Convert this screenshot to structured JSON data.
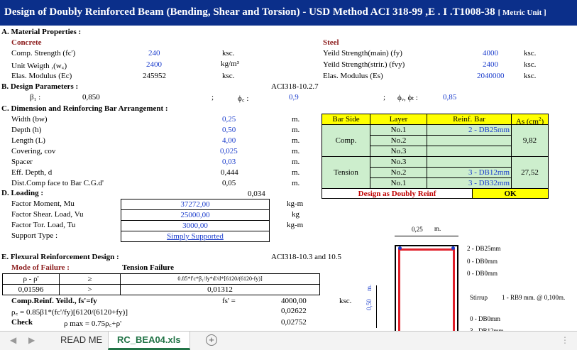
{
  "title": "Design of Doubly Reinforced Beam (Bending, Shear and Torsion) - USD Method ACI 318-99 ,E . I .T1008-38",
  "title_unit": "[ Metric Unit ]",
  "sectionA": {
    "header": "A. Material Properties :",
    "concrete_header": "Concrete",
    "steel_header": "Steel",
    "concrete_rows": [
      {
        "label": "Comp. Strength (fc')",
        "value": "240",
        "unit": "ksc."
      },
      {
        "label": "Unit Weigth ,(w꜀)",
        "value": "2400",
        "unit": "kg/m³"
      },
      {
        "label": "Elas. Modulus (Ec)",
        "value": "245952",
        "unit": "ksc."
      }
    ],
    "steel_rows": [
      {
        "label": "Yeild Strength(main) (fy)",
        "value": "4000",
        "unit": "ksc."
      },
      {
        "label": "Yeild Strength(strir.) (fvy)",
        "value": "2400",
        "unit": "ksc."
      },
      {
        "label": "Elas. Modulus (Es)",
        "value": "2040000",
        "unit": "ksc."
      }
    ]
  },
  "sectionB": {
    "header": "B. Design Parameters :",
    "aci_ref": "ACI318-10.2.7",
    "beta1_label": "β₁ :",
    "beta1_value": "0,850",
    "phib_sep": ";",
    "phib_label": "ϕ꜀ :",
    "phib_value": "0,9",
    "phivt_sep": ";",
    "phivt_label": "ϕᵥ, ϕₜ :",
    "phivt_value": "0,85"
  },
  "sectionC": {
    "header": "C. Dimension and Reinforcing Bar Arrangement :",
    "rows": [
      {
        "label": "Width (bw)",
        "value": "0,25",
        "unit": "m."
      },
      {
        "label": "Depth (h)",
        "value": "0,50",
        "unit": "m."
      },
      {
        "label": "Length (L)",
        "value": "4,00",
        "unit": "m."
      },
      {
        "label": "Covering, cov",
        "value": "0,025",
        "unit": "m."
      },
      {
        "label": "Spacer",
        "value": "0,03",
        "unit": "m."
      },
      {
        "label": "Eff. Depth, d",
        "value": "0,444",
        "unit": "m."
      },
      {
        "label": "Dist.Comp face to Bar C.G.d'",
        "value": "0,05",
        "unit": "m."
      }
    ],
    "extra_value": "0,034",
    "bar_table": {
      "headers": [
        "Bar Side",
        "Layer",
        "Reinf. Bar",
        "As (cm²)"
      ],
      "comp_label": "Comp.",
      "tension_label": "Tension",
      "comp_layers": [
        "No.1",
        "No.2",
        "No.3"
      ],
      "tension_layers": [
        "No.3",
        "No.2",
        "No.1"
      ],
      "comp_bar1": "2  -   DB25mm",
      "tension_bar2": "3  -    DB12mm",
      "tension_bar1": "3  -    DB32mm",
      "comp_as": "9,82",
      "tension_as": "27,52",
      "design_label": "Design as Doubly Reinf",
      "status": "OK"
    }
  },
  "sectionD": {
    "header": "D. Loading :",
    "rows": [
      {
        "label": "Factor Moment, Mu",
        "value": "37272,00",
        "unit": "kg-m"
      },
      {
        "label": "Factor Shear. Load, Vu",
        "value": "25000,00",
        "unit": "kg"
      },
      {
        "label": "Factor Tor. Load, Tu",
        "value": "3000,00",
        "unit": "kg-m"
      }
    ],
    "support_label": "Support  Type :",
    "support_value": "Simply Supported"
  },
  "sectionE": {
    "header": "E. Flexural Reinforcement Design :",
    "aci_ref": "ACI318-10.3 and 10.5",
    "mode_label": "Mode of Failure :",
    "mode_value": "Tension Failure",
    "table": {
      "r1c1": "ρ - ρ'",
      "r1c2": "≥",
      "r1c3": "0.85*f'c*β₁/fy*d'/d*[6120/(6120-fy)]",
      "r2c1": "0,01596",
      "r2c2": ">",
      "r2c3": "0,01312"
    },
    "comp_yield_label": "Comp.Reinf. Yeild., fs'=fy",
    "fs_label": "fs' =",
    "fs_value": "4000,00",
    "fs_unit": "ksc.",
    "rhob_label": "ρ꜀ = 0.85β1*(fc'/fy)[6120/(6120+fy)]",
    "rhob_value": "0,02622",
    "check_label": "Check",
    "rhomax_label": "ρ max = 0.75ρ꜀+ρ'",
    "rhomax_value": "0,02752"
  },
  "diagram": {
    "width_label": "0,25",
    "width_unit": "m.",
    "depth_label": "0,50",
    "depth_unit": "m.",
    "top_bars": [
      "2  -   DB25mm",
      "0  -   DB0mm",
      "0  -   DB0mm"
    ],
    "stirrup_label": "Stirrup",
    "stirrup_value": "1 -  RB9 mm. @ 0,100m.",
    "bottom_bars": [
      "0  -  DB0mm",
      "3  -  DB12mm"
    ]
  },
  "sheet_tabs": {
    "tabs": [
      "READ ME",
      "RC_BEA04.xls"
    ],
    "active": "RC_BEA04.xls",
    "add_symbol": "+",
    "prev_symbol": "◀",
    "next_symbol": "▶",
    "menu_symbol": "⋮"
  }
}
